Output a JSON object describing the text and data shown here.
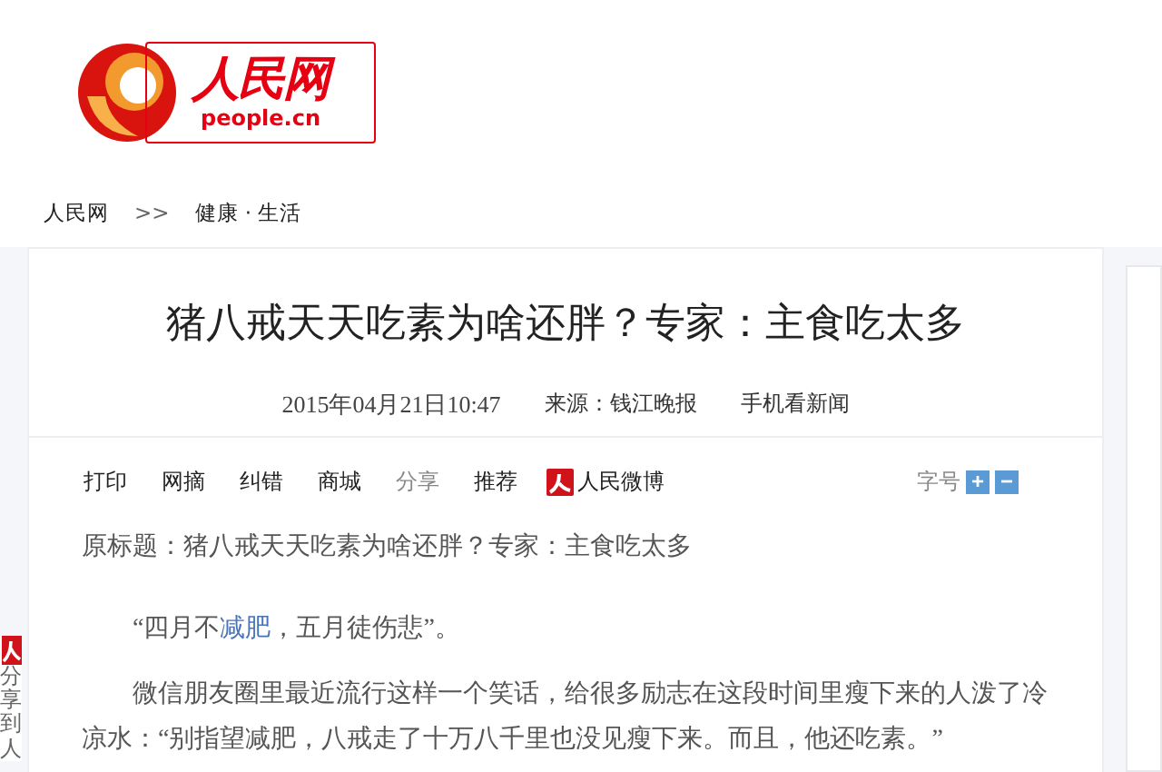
{
  "logo": {
    "name": "人民网",
    "domain": "people.cn"
  },
  "breadcrumb": {
    "items": [
      "人民网",
      "健康 · 生活"
    ],
    "separator": ">>"
  },
  "article": {
    "title": "猪八戒天天吃素为啥还胖？专家：主食吃太多",
    "meta": [
      "2015年04月21日10:47",
      "来源：钱江晚报",
      "手机看新闻"
    ],
    "toolbar": [
      {
        "kind": "text",
        "label": "打印",
        "disabled": false
      },
      {
        "kind": "text",
        "label": "网摘",
        "disabled": false
      },
      {
        "kind": "text",
        "label": "纠错",
        "disabled": false
      },
      {
        "kind": "text",
        "label": "商城",
        "disabled": false
      },
      {
        "kind": "text",
        "label": "分享",
        "disabled": true
      },
      {
        "kind": "text",
        "label": "推荐",
        "disabled": false
      },
      {
        "kind": "weibo",
        "label": "人民微博",
        "disabled": false
      }
    ],
    "font_size": {
      "label": "字号",
      "increase": "+",
      "decrease": "−"
    },
    "body": [
      {
        "kind": "plain",
        "parts": [
          {
            "text": "原标题：猪八戒天天吃素为啥还胖？专家：主食吃太多",
            "link": false
          }
        ]
      },
      {
        "kind": "indented",
        "parts": [
          {
            "text": "“四月不",
            "link": false
          },
          {
            "text": "减肥",
            "link": true
          },
          {
            "text": "，五月徒伤悲”。",
            "link": false
          }
        ]
      },
      {
        "kind": "indented",
        "parts": [
          {
            "text": "微信朋友圈里最近流行这样一个笑话，给很多励志在这段时间里瘦下来的人泼了冷凉水：“别指望减肥，八戒走了十万八千里也没见瘦下来。而且，他还吃素。”",
            "link": false
          }
        ]
      }
    ]
  },
  "share": {
    "label": "分享到人"
  }
}
